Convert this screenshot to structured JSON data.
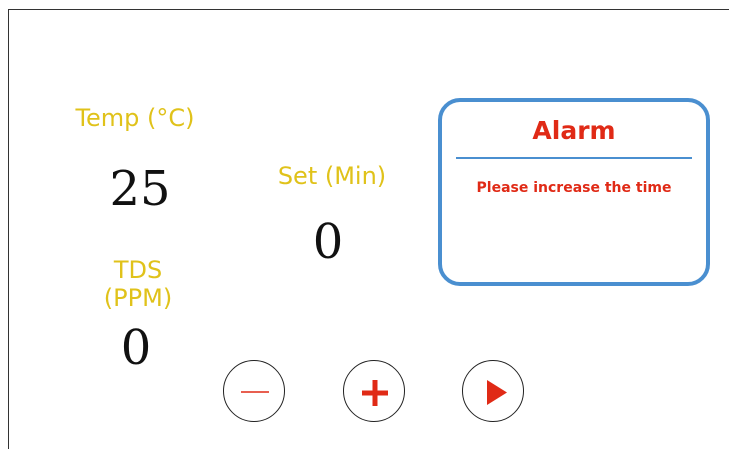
{
  "temperature": {
    "label": "Temp (°C)",
    "value": "25"
  },
  "set_time": {
    "label": "Set (Min)",
    "value": "0"
  },
  "tds": {
    "label": "TDS (PPM)",
    "value": "0"
  },
  "alarm": {
    "title": "Alarm",
    "message": "Please increase the time"
  },
  "controls": [
    {
      "name": "decrease-button",
      "icon": "minus-icon"
    },
    {
      "name": "increase-button",
      "icon": "plus-icon"
    },
    {
      "name": "start-button",
      "icon": "play-icon"
    }
  ],
  "colors": {
    "label": "#e0c21a",
    "value": "#111111",
    "alarm_text": "#e02a16",
    "alarm_border": "#4a8fd0",
    "icon": "#e02a16"
  }
}
